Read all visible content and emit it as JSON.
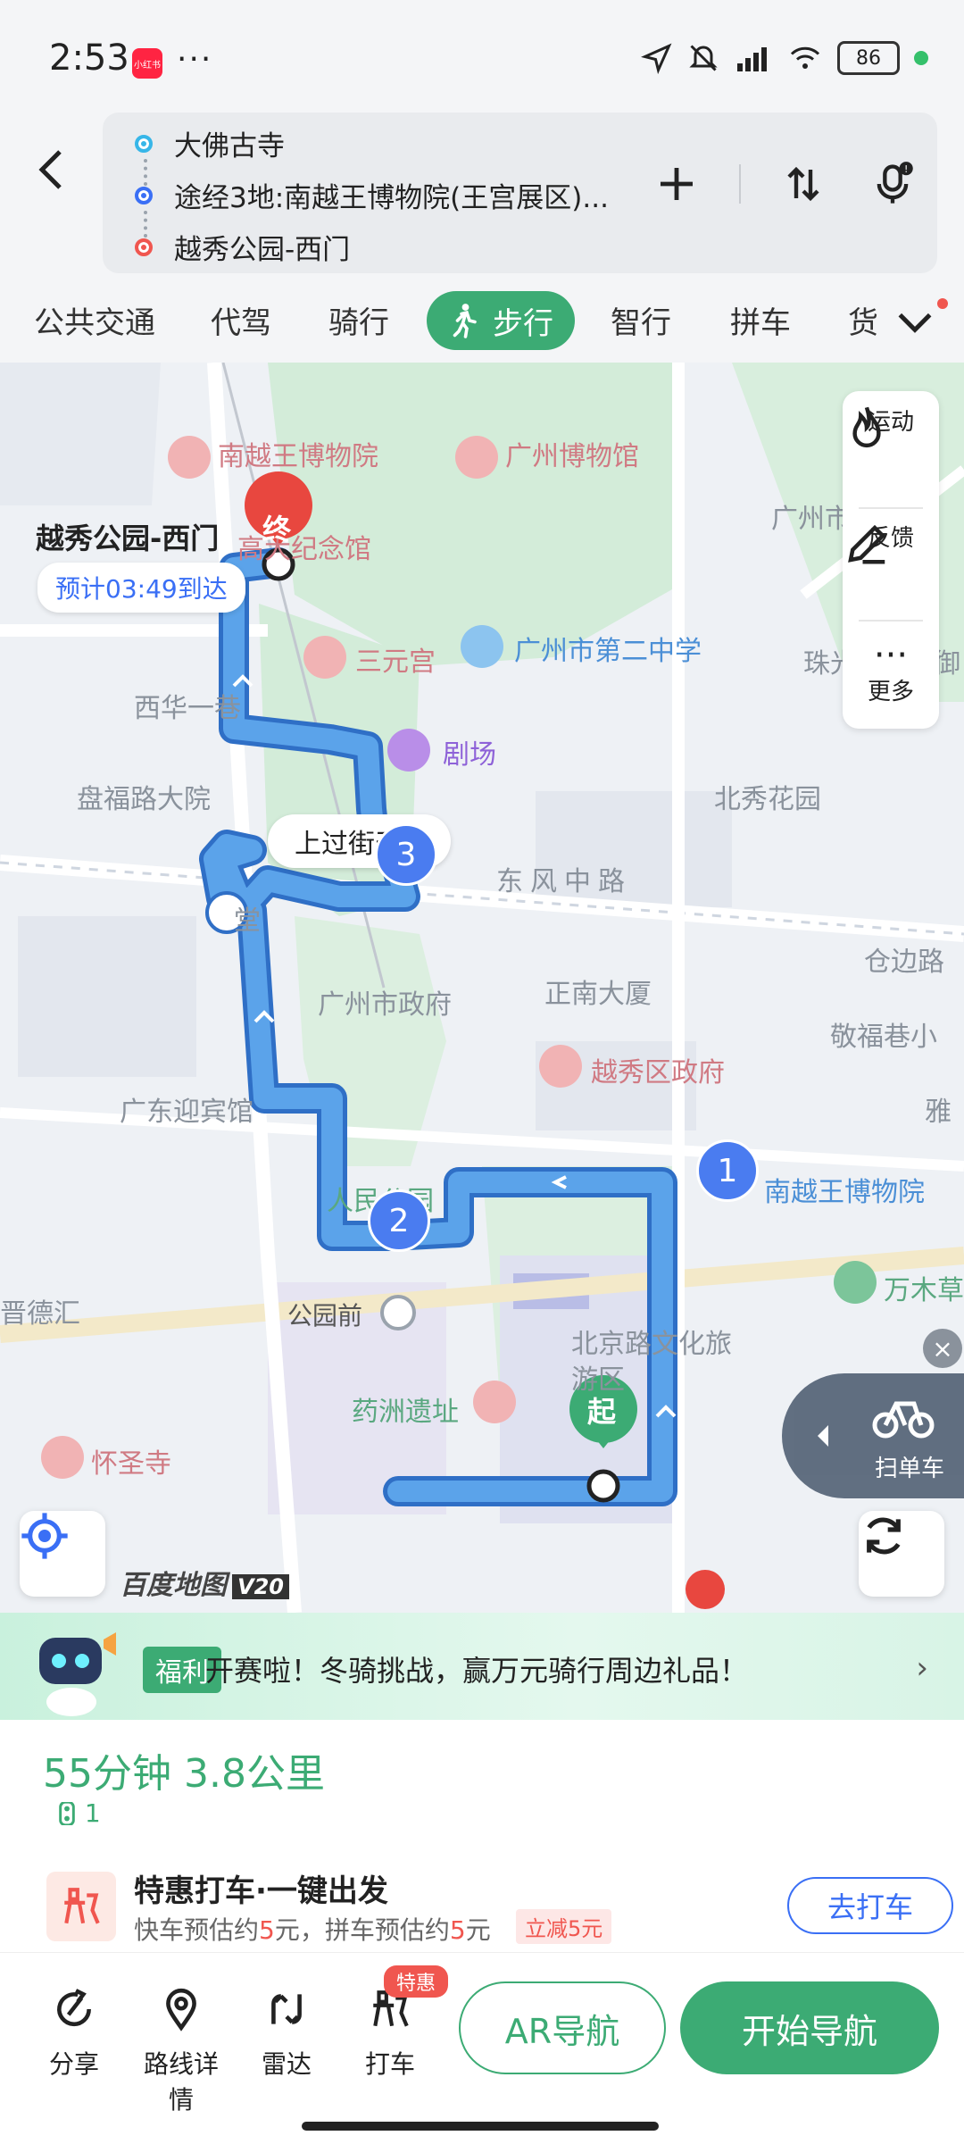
{
  "status_bar": {
    "time": "2:53",
    "app_badge": "小红书",
    "dots": "···",
    "battery": "86"
  },
  "header": {
    "origin": "大佛古寺",
    "waypoints": "途经3地:南越王博物院(王宫展区)...",
    "destination": "越秀公园-西门"
  },
  "mode_tabs": [
    "公共交通",
    "代驾",
    "骑行",
    "步行",
    "智行",
    "拼车",
    "货"
  ],
  "active_tab": "步行",
  "map": {
    "labels": {
      "nanyue_museum_top": "南越王博物院",
      "gz_museum": "广州博物馆",
      "commemoration": "高大纪念馆",
      "sanyuan": "三元宫",
      "second_school": "广州市第二中学",
      "xihua": "西华一巷",
      "theater": "剧场",
      "panfu": "盘福路大院",
      "beixiu": "北秀花园",
      "dongfeng": "东风中路",
      "zhengnan": "正南大厦",
      "gz_gov": "广州市政府",
      "yuexiu_gov": "越秀区政府",
      "jingfu": "敬福巷小",
      "guest_house": "广东迎宾馆",
      "people_park": "人民公园",
      "nanyue_museum": "南越王博物院",
      "wanmu": "万木草",
      "gongyuanqian": "公园前",
      "beijing_rd": "北京路文化旅游区",
      "yaozhou": "药洲遗址",
      "huaisheng": "怀圣寺",
      "jide": "晋德汇",
      "cangbian": "仓边路",
      "zhuguang": "珠光",
      "ya": "雅",
      "tang": "堂",
      "guangzhou_partial": "广州市",
      "yu": "御"
    },
    "destination_name": "越秀公园-西门",
    "eta": "预计03:49到达",
    "callout": "上过街天",
    "marker_end": "终",
    "marker_start": "起",
    "markers": [
      "1",
      "2",
      "3"
    ],
    "side_panel": {
      "sport": "运动",
      "feedback": "反馈",
      "more": "更多"
    },
    "bike_btn": "扫单车",
    "brand": "百度地图",
    "brand_version": "V20"
  },
  "promo": {
    "tag": "福利",
    "text": "开赛啦！冬骑挑战，赢万元骑行周边礼品！",
    "arrow": "›"
  },
  "route_card": {
    "summary": "55分钟 3.8公里",
    "sub": "1",
    "taxi_title": "特惠打车·一键出发",
    "taxi_desc_1": "快车预估约",
    "taxi_price_1": "5",
    "taxi_desc_2": "元，拼车预估约",
    "taxi_price_2": "5",
    "taxi_desc_3": "元",
    "taxi_discount": "立减5元",
    "taxi_button": "去打车"
  },
  "bottom_bar": {
    "share": "分享",
    "details": "路线详情",
    "radar": "雷达",
    "taxi": "打车",
    "taxi_tag": "特惠",
    "ar_nav": "AR导航",
    "start_nav": "开始导航"
  },
  "colors": {
    "accent": "#3cab74",
    "route": "#4b8fe0",
    "primary_blue": "#3a6ff5",
    "alert_red": "#f0564f"
  }
}
